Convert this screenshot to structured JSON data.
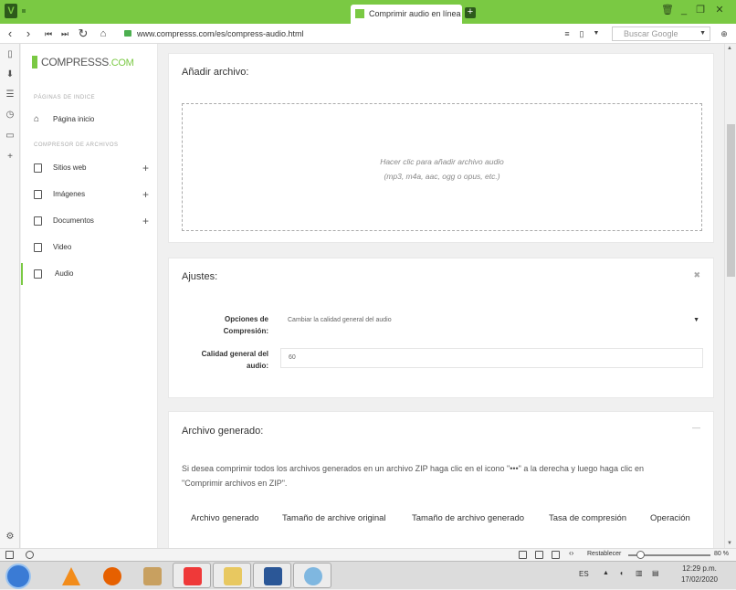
{
  "browser": {
    "tab_title": "Comprimir audio en línea",
    "url": "www.compresss.com/es/compress-audio.html",
    "search_placeholder": "Buscar Google",
    "new_tab_label": "+",
    "reset_label": "Restablecer",
    "zoom": "80 %",
    "accent_color": "#7ac943"
  },
  "sidebar": {
    "brand_main": "COMPRESSS",
    "brand_suffix": ".COM",
    "section_index": "PÁGINAS DE INDICE",
    "home_label": "Página inicio",
    "section_compress": "COMPRESOR DE ARCHIVOS",
    "items": [
      {
        "label": "Sitios web",
        "icon": "sites-icon"
      },
      {
        "label": "Imágenes",
        "icon": "image-icon"
      },
      {
        "label": "Documentos",
        "icon": "document-icon"
      },
      {
        "label": "Video",
        "icon": "video-icon"
      },
      {
        "label": "Audio",
        "icon": "audio-icon"
      }
    ]
  },
  "add_file": {
    "title": "Añadir archivo:",
    "drop_line1": "Hacer clic para añadir archivo audio",
    "drop_line2": "(mp3, m4a, aac, ogg o opus, etc.)"
  },
  "settings": {
    "title": "Ajustes:",
    "options_label_1": "Opciones de",
    "options_label_2": "Compresión:",
    "options_value": "Cambiar la calidad general del audio",
    "quality_label_1": "Calidad general del",
    "quality_label_2": "audio:",
    "quality_value": "60"
  },
  "output": {
    "title": "Archivo generado:",
    "note_line1": "Si desea comprimir todos los archivos generados en un archivo ZIP haga clic en el icono \"•••\" a la derecha y luego haga clic en",
    "note_line2": "\"Comprimir archivos en ZIP\".",
    "columns": [
      "Archivo generado",
      "Tamaño de archive original",
      "Tamaño de archivo generado",
      "Tasa de compresión",
      "Operación"
    ]
  },
  "taskbar": {
    "lang": "ES",
    "time": "12:29 p.m.",
    "date": "17/02/2020"
  }
}
